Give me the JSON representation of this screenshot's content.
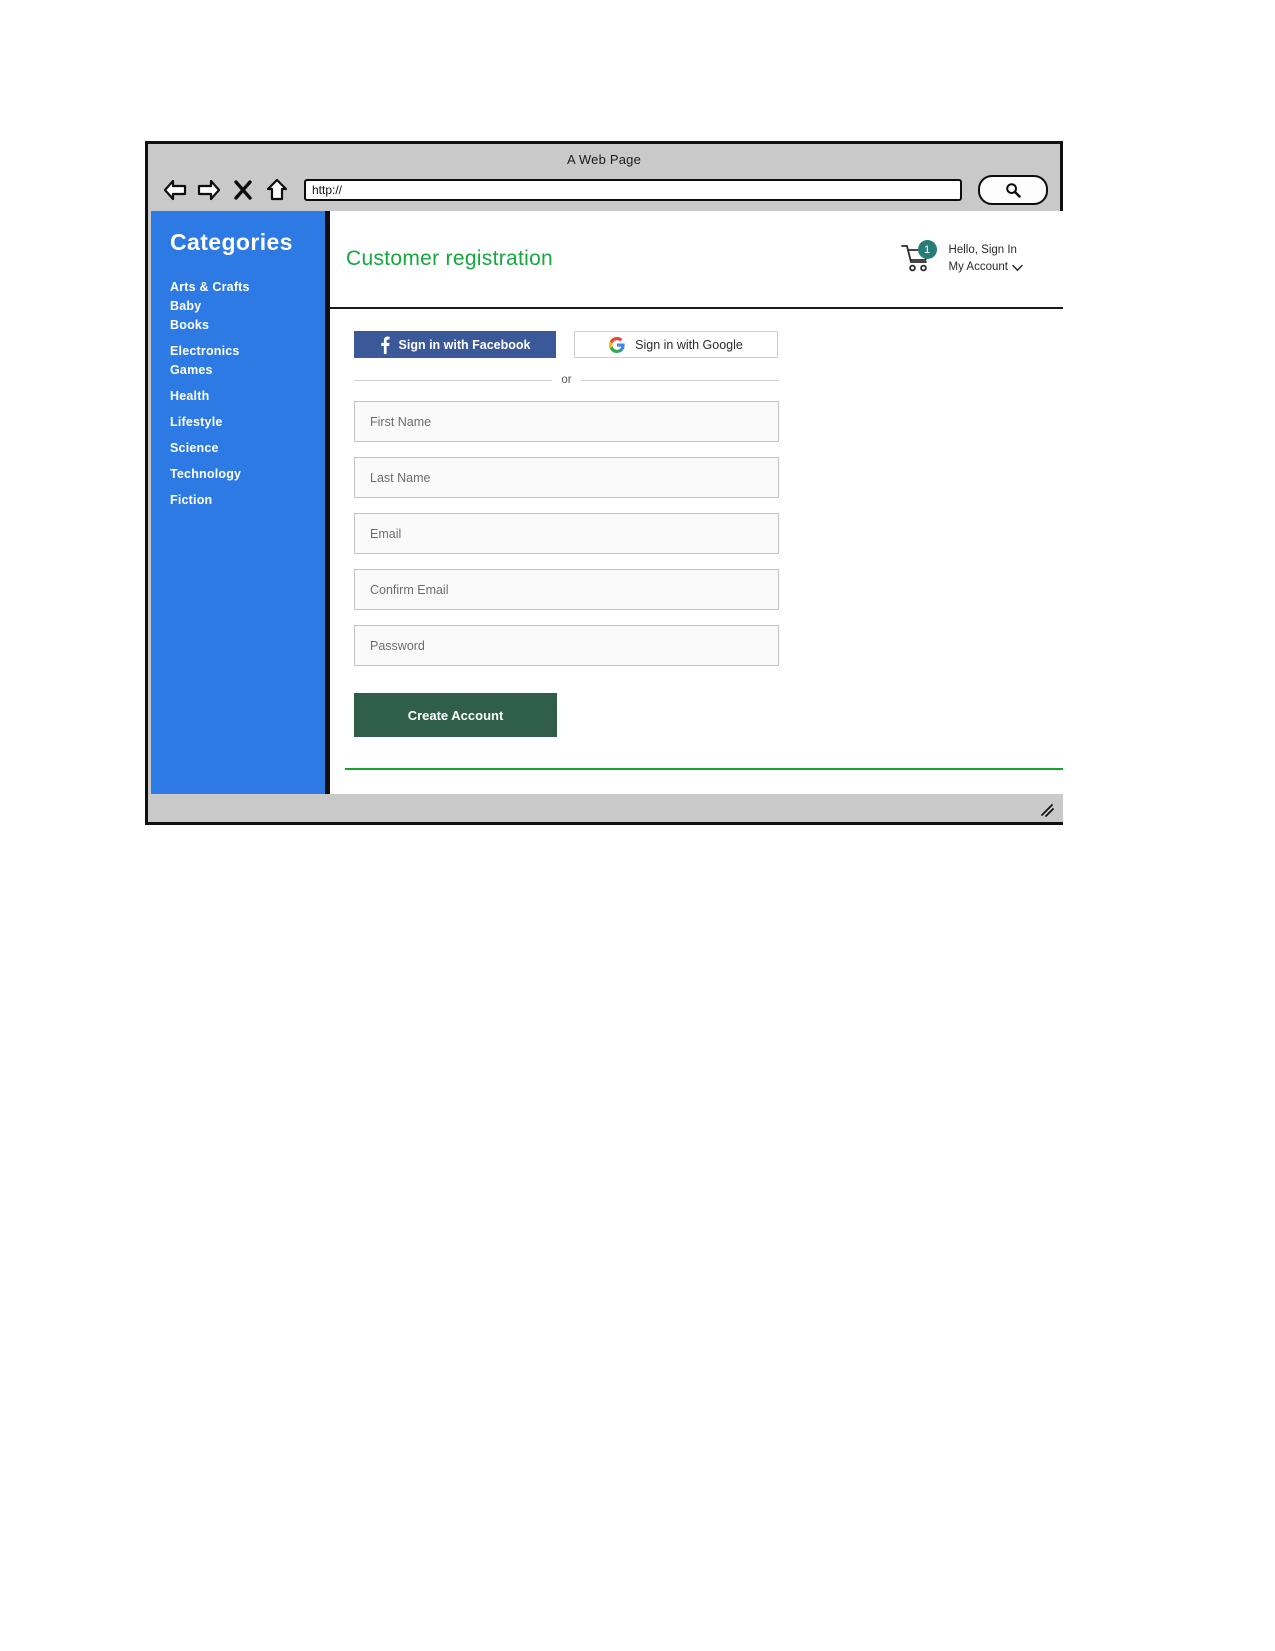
{
  "browser": {
    "title": "A Web Page",
    "url_value": "http://",
    "url_placeholder": "http://",
    "nav": {
      "back": "back-arrow",
      "forward": "forward-arrow",
      "stop": "close-x",
      "home": "home"
    },
    "search_icon": "search-icon"
  },
  "sidebar": {
    "title": "Categories",
    "items": [
      {
        "label": "Arts & Crafts",
        "gap": "sm"
      },
      {
        "label": "Baby",
        "gap": "sm"
      },
      {
        "label": "Books",
        "gap": "sm"
      },
      {
        "label": "Electronics",
        "gap": "md"
      },
      {
        "label": "Games",
        "gap": "sm"
      },
      {
        "label": "Health",
        "gap": "md"
      },
      {
        "label": "Lifestyle",
        "gap": "md"
      },
      {
        "label": "Science",
        "gap": "md"
      },
      {
        "label": "Technology",
        "gap": "md"
      },
      {
        "label": "Fiction",
        "gap": "md"
      }
    ]
  },
  "header": {
    "page_title": "Customer registration",
    "cart_count": "1",
    "greeting": "Hello, Sign In",
    "account_label": "My Account",
    "account_chevron": "chevron-down-icon"
  },
  "form": {
    "facebook_label": "Sign in with Facebook",
    "google_label": "Sign in with Google",
    "or_label": "or",
    "fields": [
      {
        "name": "first-name",
        "placeholder": "First Name",
        "value": ""
      },
      {
        "name": "last-name",
        "placeholder": "Last Name",
        "value": ""
      },
      {
        "name": "email",
        "placeholder": "Email",
        "value": ""
      },
      {
        "name": "confirm-email",
        "placeholder": "Confirm Email",
        "value": ""
      },
      {
        "name": "password",
        "placeholder": "Password",
        "value": ""
      }
    ],
    "submit_label": "Create Account"
  },
  "colors": {
    "sidebar_blue": "#2d7ae5",
    "title_green": "#16a73f",
    "facebook_blue": "#3b5998",
    "submit_green": "#2f5e4b",
    "cart_badge_teal": "#267d78",
    "rule_green": "#19a330"
  }
}
